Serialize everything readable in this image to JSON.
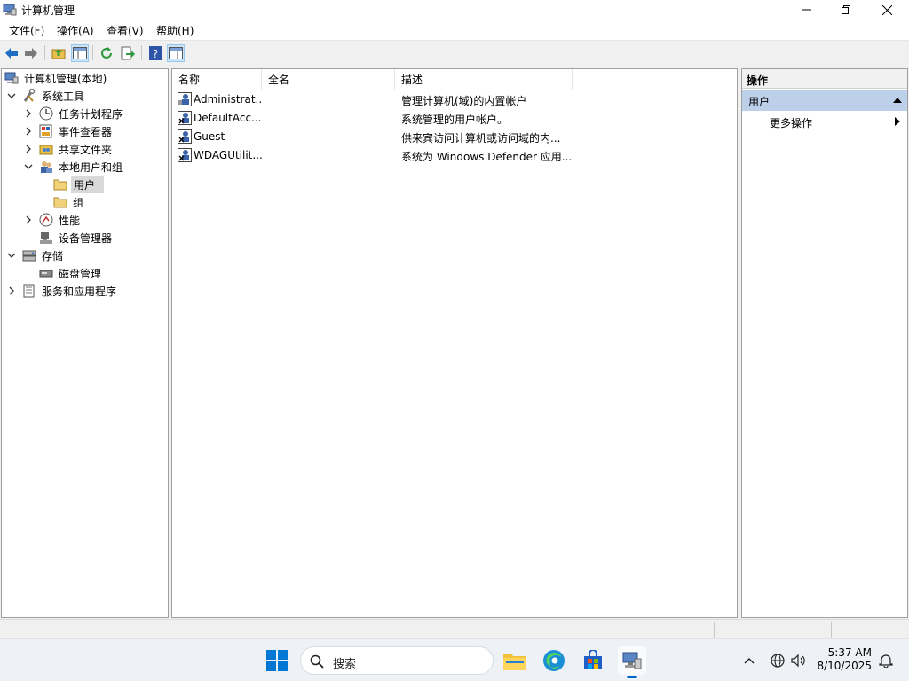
{
  "window": {
    "title": "计算机管理"
  },
  "menu": [
    "文件(F)",
    "操作(A)",
    "查看(V)",
    "帮助(H)"
  ],
  "tree": {
    "root": "计算机管理(本地)",
    "system_tools": "系统工具",
    "task_scheduler": "任务计划程序",
    "event_viewer": "事件查看器",
    "shared_folders": "共享文件夹",
    "local_users_groups": "本地用户和组",
    "users": "用户",
    "groups": "组",
    "performance": "性能",
    "device_manager": "设备管理器",
    "storage": "存储",
    "disk_management": "磁盘管理",
    "services_apps": "服务和应用程序"
  },
  "list": {
    "headers": [
      "名称",
      "全名",
      "描述"
    ],
    "rows": [
      {
        "name": "Administrat...",
        "full_name": "",
        "description": "管理计算机(域)的内置帐户"
      },
      {
        "name": "DefaultAcc...",
        "full_name": "",
        "description": "系统管理的用户帐户。"
      },
      {
        "name": "Guest",
        "full_name": "",
        "description": "供来宾访问计算机或访问域的内..."
      },
      {
        "name": "WDAGUtilit...",
        "full_name": "",
        "description": "系统为 Windows Defender 应用..."
      }
    ]
  },
  "actions": {
    "title": "操作",
    "section": "用户",
    "more": "更多操作"
  },
  "taskbar": {
    "search_placeholder": "搜索",
    "time": "5:37 AM",
    "date": "8/10/2025"
  },
  "colors": {
    "selection": "#d9d9d9",
    "action_header": "#bcd0ea",
    "accent": "#0067c0"
  }
}
